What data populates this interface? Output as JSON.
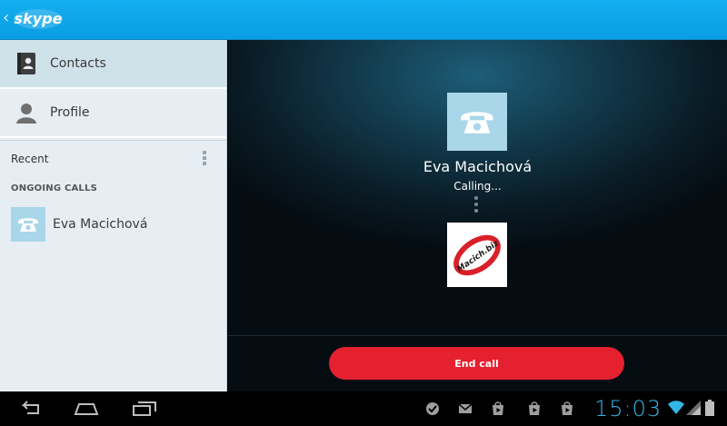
{
  "app": {
    "logo_text": "skype",
    "brand_color": "#12aef0"
  },
  "sidebar": {
    "items": [
      {
        "label": "Contacts",
        "icon": "contacts-book-icon",
        "active": true
      },
      {
        "label": "Profile",
        "icon": "person-icon",
        "active": false
      }
    ],
    "recent_label": "Recent",
    "ongoing_header": "ONGOING CALLS",
    "ongoing_calls": [
      {
        "name": "Eva Macichová",
        "icon": "telephone-icon"
      }
    ]
  },
  "call": {
    "callee_name": "Eva Macichová",
    "status": "Calling...",
    "my_avatar_text": "Macich.biz",
    "end_call_label": "End call",
    "end_call_color": "#e5202f"
  },
  "system_bar": {
    "time": "15:03",
    "clock_color": "#33b5e5",
    "nav_icons": [
      "back-icon",
      "home-icon",
      "recent-apps-icon"
    ],
    "notification_icons": [
      "check-bubble-icon",
      "mail-icon",
      "play-store-icon",
      "play-store-icon",
      "play-store-icon"
    ]
  }
}
